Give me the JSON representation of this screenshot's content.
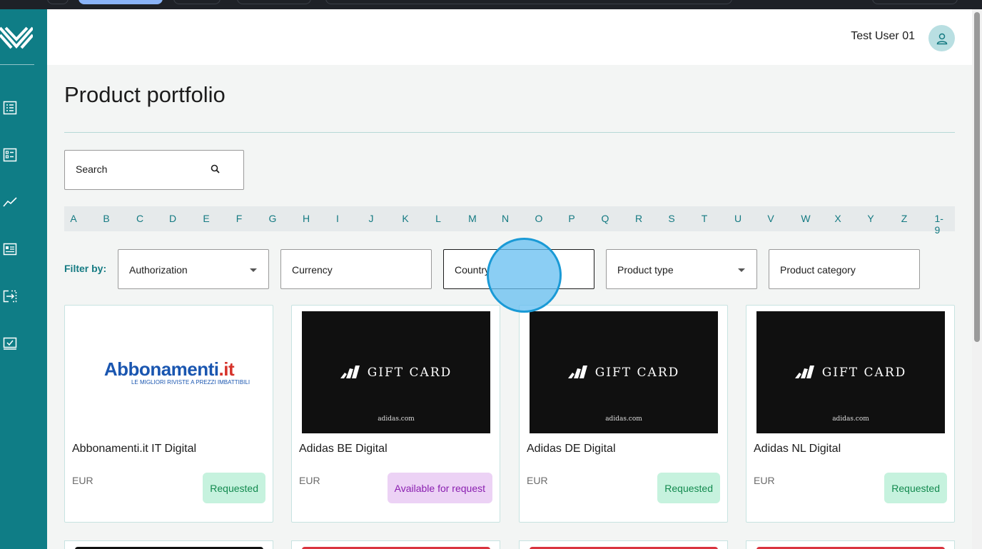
{
  "header": {
    "user_name": "Test User 01"
  },
  "page": {
    "title": "Product portfolio"
  },
  "search": {
    "placeholder": "Search"
  },
  "alphabet": [
    "A",
    "B",
    "C",
    "D",
    "E",
    "F",
    "G",
    "H",
    "I",
    "J",
    "K",
    "L",
    "M",
    "N",
    "O",
    "P",
    "Q",
    "R",
    "S",
    "T",
    "U",
    "V",
    "W",
    "X",
    "Y",
    "Z",
    "1-9"
  ],
  "filters": {
    "label": "Filter by:",
    "items": [
      {
        "label": "Authorization",
        "dropdown": true
      },
      {
        "label": "Currency",
        "dropdown": false
      },
      {
        "label": "Country",
        "dropdown": false
      },
      {
        "label": "Product type",
        "dropdown": true
      },
      {
        "label": "Product category",
        "dropdown": false
      }
    ]
  },
  "products": [
    {
      "name": "Abbonamenti.it IT Digital",
      "currency": "EUR",
      "status": "Requested",
      "status_kind": "requested",
      "image": "abbonamenti-logo"
    },
    {
      "name": "Adidas BE Digital",
      "currency": "EUR",
      "status": "Available for request",
      "status_kind": "available",
      "image": "adidas-gift-card"
    },
    {
      "name": "Adidas DE Digital",
      "currency": "EUR",
      "status": "Requested",
      "status_kind": "requested",
      "image": "adidas-gift-card"
    },
    {
      "name": "Adidas NL Digital",
      "currency": "EUR",
      "status": "Requested",
      "status_kind": "requested",
      "image": "adidas-gift-card"
    }
  ],
  "images": {
    "abbonamenti": {
      "brand": "Abbonamenti",
      "tld": ".it",
      "tagline": "LE MIGLIORI RIVISTE A PREZZI IMBATTIBILI"
    },
    "adidas": {
      "text": "GIFT CARD",
      "url": "adidas.com"
    }
  },
  "colors": {
    "sidebar": "#0f7d86",
    "accent": "#147a82",
    "requested_bg": "#c6f2de",
    "requested_fg": "#138a4f",
    "available_bg": "#ecd2f5",
    "available_fg": "#8a1fb0"
  },
  "sidebar_icons": [
    "list-icon",
    "checklist-icon",
    "trend-chart-icon",
    "article-icon",
    "transfer-icon",
    "approval-icon"
  ]
}
